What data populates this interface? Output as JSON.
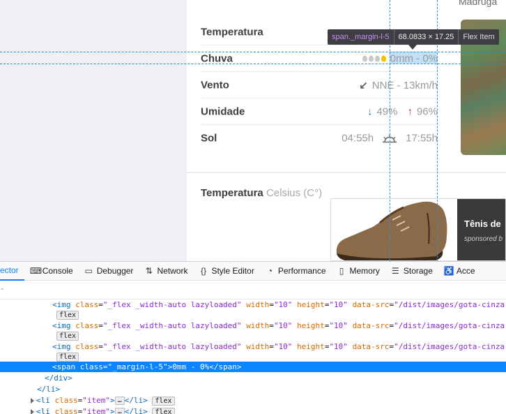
{
  "page": {
    "top_label": "Madruga",
    "rows": [
      {
        "label": "Temperatura",
        "value": ""
      },
      {
        "label": "Chuva",
        "value": "0mm - 0%"
      },
      {
        "label": "Vento",
        "value": "NNE - 13km/h",
        "icon": "wind-direction-arrow-icon"
      },
      {
        "label": "Umidade",
        "min": "49%",
        "max": "96%"
      },
      {
        "label": "Sol",
        "sunrise": "04:55h",
        "sunset": "17:55h",
        "icon": "sunrise-icon"
      }
    ],
    "temperature_heading": {
      "bold": "Temperatura",
      "light": "Celsius (C°)"
    },
    "ad": {
      "title": "Tênis de",
      "sponsor": "sponsored b"
    },
    "colors": {
      "arrow_down": "#1a8ad4",
      "arrow_up": "#e0262a",
      "drop_active": "#f2c400",
      "drop": "#c9c9c9"
    }
  },
  "tooltip": {
    "tag": "span._margin-l-5",
    "dims": "68.0833 × 17.25",
    "type": "Flex Item"
  },
  "devtools": {
    "tabs": [
      {
        "label": "ector",
        "icon": "",
        "selected": true
      },
      {
        "label": "Console",
        "icon": "console-icon"
      },
      {
        "label": "Debugger",
        "icon": "debugger-icon"
      },
      {
        "label": "Network",
        "icon": "network-icon"
      },
      {
        "label": "Style Editor",
        "icon": "style-editor-icon"
      },
      {
        "label": "Performance",
        "icon": "performance-icon"
      },
      {
        "label": "Memory",
        "icon": "memory-icon"
      },
      {
        "label": "Storage",
        "icon": "storage-icon"
      },
      {
        "label": "Acce",
        "icon": "accessibility-icon"
      }
    ],
    "search_caret": "-",
    "img_line": {
      "tag_open": "<img",
      "class_attr": "class",
      "class_val": "\"_flex _width-auto lazyloaded\"",
      "width_attr": "width",
      "width_val": "\"10\"",
      "height_attr": "height",
      "height_val": "\"10\"",
      "src_attr": "data-src",
      "src_val": "\"/dist/images/gota-cinza",
      "badge": "flex"
    },
    "span_line": {
      "open": "<span",
      "class_attr": "class",
      "class_val": "\"_margin-l-5\"",
      "text": ">0mm - 0%</span>"
    },
    "div_close": "</div>",
    "li_close": "</li>",
    "li_item": {
      "open": "<li",
      "class_attr": "class",
      "class_val": "\"item\"",
      "ellipsis": "…",
      "close": "</li>",
      "badge": "flex"
    }
  }
}
